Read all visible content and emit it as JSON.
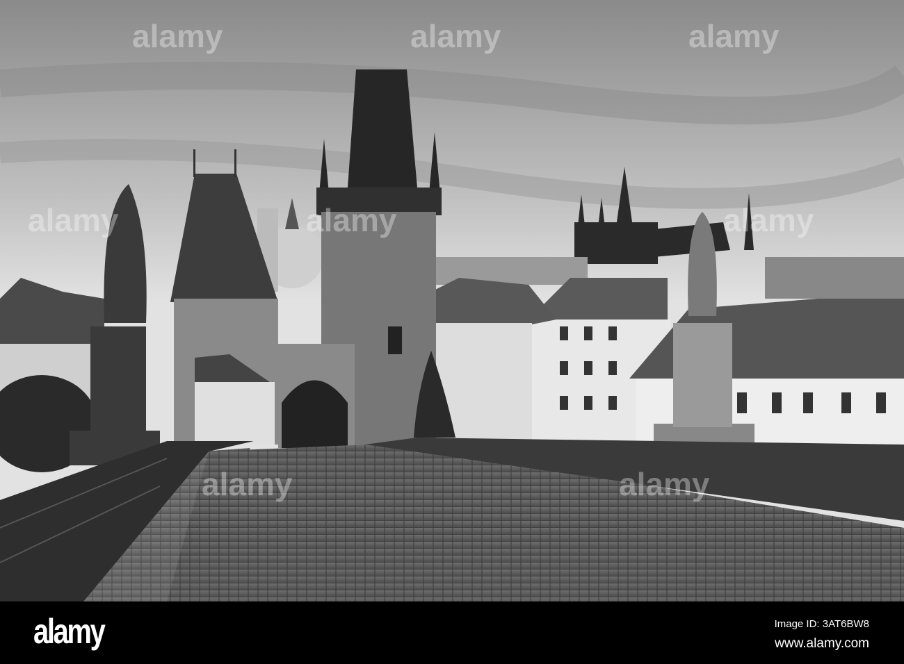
{
  "photo": {
    "subject": "Charles Bridge, Prague",
    "mode": "black-and-white"
  },
  "watermark": {
    "text": "alamy"
  },
  "footer": {
    "logo": "alamy",
    "image_id": "Image ID: 3AT6BW8",
    "url": "www.alamy.com"
  }
}
